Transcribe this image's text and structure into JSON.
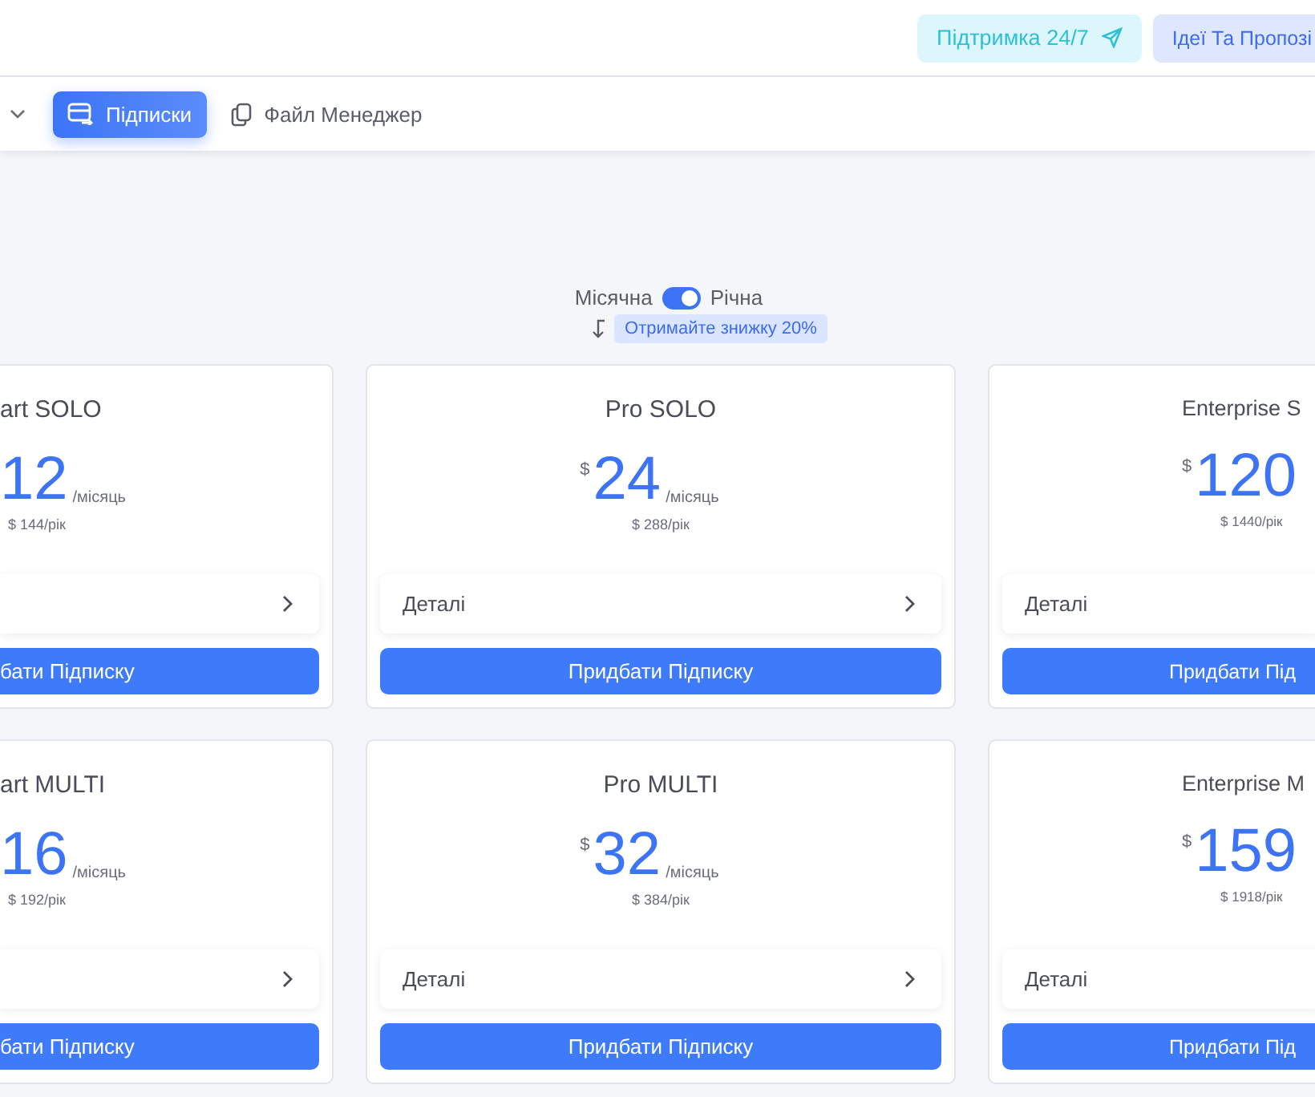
{
  "header": {
    "support_button": "Підтримка 24/7",
    "ideas_button": "Ідеї Та Пропозі"
  },
  "nav": {
    "items": [
      {
        "label": "Підписки",
        "selected": true,
        "kind": "card"
      },
      {
        "label": "Файл Менеджер",
        "selected": false,
        "kind": "files"
      }
    ]
  },
  "billing": {
    "monthly_label": "Місячна",
    "yearly_label": "Річна",
    "yearly_on": true,
    "discount_badge": "Отримайте знижку 20%"
  },
  "plan_rows": [
    {
      "plans": [
        {
          "title": "art SOLO",
          "price": "12",
          "period": "/місяць",
          "yearly": "$ 144/рік",
          "buy": "бати Підписку"
        },
        {
          "title": "Pro SOLO",
          "currency": "$",
          "price": "24",
          "period": "/місяць",
          "yearly": "$ 288/рік",
          "details": "Деталі",
          "buy": "Придбати Підписку"
        },
        {
          "title": "Enterprise S",
          "currency": "$",
          "price": "120",
          "yearly": "$ 1440/рік",
          "details": "Деталі",
          "buy": "Придбати Під"
        }
      ]
    },
    {
      "plans": [
        {
          "title": "art MULTI",
          "price": "16",
          "period": "/місяць",
          "yearly": "$ 192/рік",
          "buy": "бати Підписку"
        },
        {
          "title": "Pro MULTI",
          "currency": "$",
          "price": "32",
          "period": "/місяць",
          "yearly": "$ 384/рік",
          "details": "Деталі",
          "buy": "Придбати Підписку"
        },
        {
          "title": "Enterprise M",
          "currency": "$",
          "price": "159",
          "yearly": "$ 1918/рік",
          "details": "Деталі",
          "buy": "Придбати Під"
        }
      ]
    }
  ]
}
